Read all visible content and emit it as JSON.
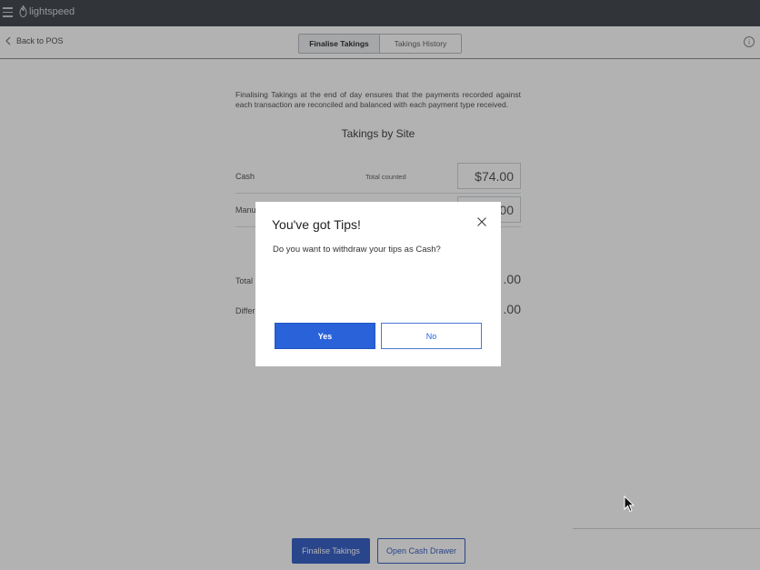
{
  "topbar": {
    "brand": "lightspeed"
  },
  "subnav": {
    "back_label": "Back to POS",
    "tabs": [
      {
        "label": "Finalise Takings",
        "active": true
      },
      {
        "label": "Takings History",
        "active": false
      }
    ],
    "info_glyph": "i"
  },
  "main": {
    "intro": "Finalising Takings at the end of day ensures that the payments recorded against each transaction are reconciled and balanced with each payment type received.",
    "section_title": "Takings by Site",
    "rows": [
      {
        "name": "Cash",
        "sub": "Total counted",
        "amount": "$74.00"
      },
      {
        "name": "Manu",
        "sub": "",
        "amount": "00"
      }
    ],
    "totals": [
      {
        "label": "Total",
        "value": ".00"
      },
      {
        "label": "Differ",
        "value": ".00"
      }
    ]
  },
  "footer": {
    "finalise_label": "Finalise Takings",
    "open_drawer_label": "Open Cash Drawer"
  },
  "modal": {
    "title": "You've got Tips!",
    "message": "Do you want to withdraw your tips as Cash?",
    "yes_label": "Yes",
    "no_label": "No"
  },
  "colors": {
    "topbar": "#474c53",
    "primary": "#2962d9",
    "overlay": "rgba(0,0,0,0.30)"
  }
}
